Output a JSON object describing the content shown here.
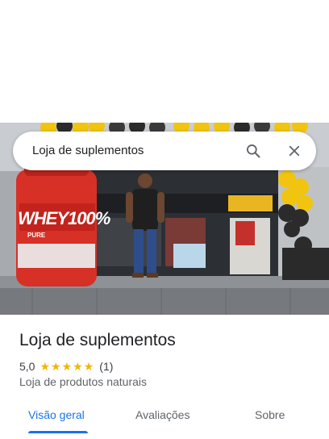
{
  "search": {
    "query": "Loja de suplementos",
    "search_icon": "search-icon",
    "close_icon": "close-icon"
  },
  "hero": {
    "brand_text": "WHEY100%",
    "pure_text": "PURE"
  },
  "place": {
    "title": "Loja de suplementos",
    "rating_value": "5,0",
    "rating_stars": 5,
    "review_count": "(1)",
    "category": "Loja de produtos naturais"
  },
  "tabs": [
    {
      "label": "Visão geral",
      "active": true
    },
    {
      "label": "Avaliações",
      "active": false
    },
    {
      "label": "Sobre",
      "active": false
    }
  ],
  "colors": {
    "accent": "#1a73e8",
    "star": "#f4b400",
    "text_primary": "#202124",
    "text_secondary": "#5f6368"
  }
}
